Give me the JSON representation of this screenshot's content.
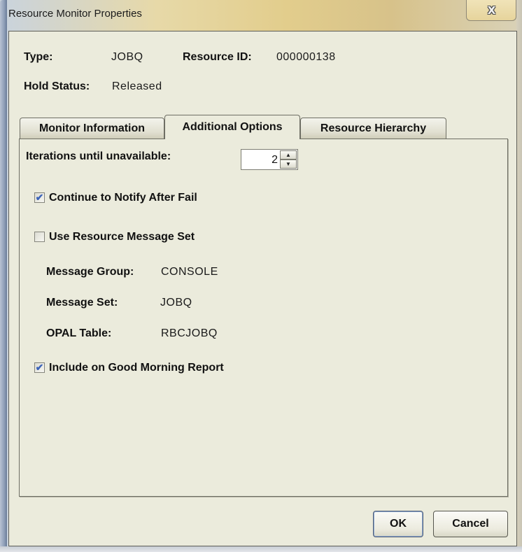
{
  "window": {
    "title": "Resource Monitor Properties",
    "close_icon": "close-icon"
  },
  "header": {
    "type_label": "Type:",
    "type_value": "JOBQ",
    "resource_id_label": "Resource ID:",
    "resource_id_value": "000000138",
    "hold_status_label": "Hold Status:",
    "hold_status_value": "Released"
  },
  "tabs": [
    {
      "label": "Monitor Information",
      "active": false
    },
    {
      "label": "Additional Options",
      "active": true
    },
    {
      "label": "Resource Hierarchy",
      "active": false
    }
  ],
  "options": {
    "iterations_label": "Iterations until unavailable:",
    "iterations_value": "2",
    "continue_notify": {
      "label": "Continue to Notify After Fail",
      "checked": true
    },
    "use_message_set": {
      "label": "Use Resource Message Set",
      "checked": false
    },
    "message_group_label": "Message Group:",
    "message_group_value": "CONSOLE",
    "message_set_label": "Message Set:",
    "message_set_value": "JOBQ",
    "opal_table_label": "OPAL Table:",
    "opal_table_value": "RBCJOBQ",
    "good_morning": {
      "label": "Include on Good Morning Report",
      "checked": true
    }
  },
  "buttons": {
    "ok_label": "OK",
    "cancel_label": "Cancel"
  },
  "icons": {
    "checkmark": "✔",
    "spin_up": "▲",
    "spin_down": "▼",
    "close": "X"
  }
}
